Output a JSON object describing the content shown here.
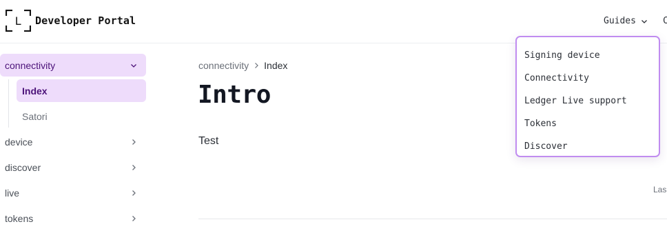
{
  "header": {
    "logo_letter": "L",
    "brand": "Developer Portal",
    "nav": {
      "guides_label": "Guides",
      "next_label_partial": "C"
    }
  },
  "guides_menu": {
    "items": [
      {
        "label": "Signing device"
      },
      {
        "label": "Connectivity"
      },
      {
        "label": "Ledger Live support"
      },
      {
        "label": "Tokens"
      },
      {
        "label": "Discover"
      }
    ]
  },
  "sidebar": {
    "sections": [
      {
        "label": "connectivity",
        "expanded": true,
        "children": [
          {
            "label": "Index",
            "active": true
          },
          {
            "label": "Satori",
            "active": false
          }
        ]
      },
      {
        "label": "device",
        "expanded": false
      },
      {
        "label": "discover",
        "expanded": false
      },
      {
        "label": "live",
        "expanded": false
      },
      {
        "label": "tokens",
        "expanded": false
      }
    ]
  },
  "main": {
    "breadcrumb": {
      "parent": "connectivity",
      "current": "Index"
    },
    "title": "Intro",
    "body": "Test",
    "last_updated_partial": "Las"
  },
  "colors": {
    "accent": "#c08cf0",
    "active_bg": "#eedcfb",
    "active_text": "#4b1279"
  },
  "icons": {
    "chevron_down": "chevron-down-icon",
    "chevron_right": "chevron-right-icon",
    "logo": "ledger-logo-icon"
  }
}
